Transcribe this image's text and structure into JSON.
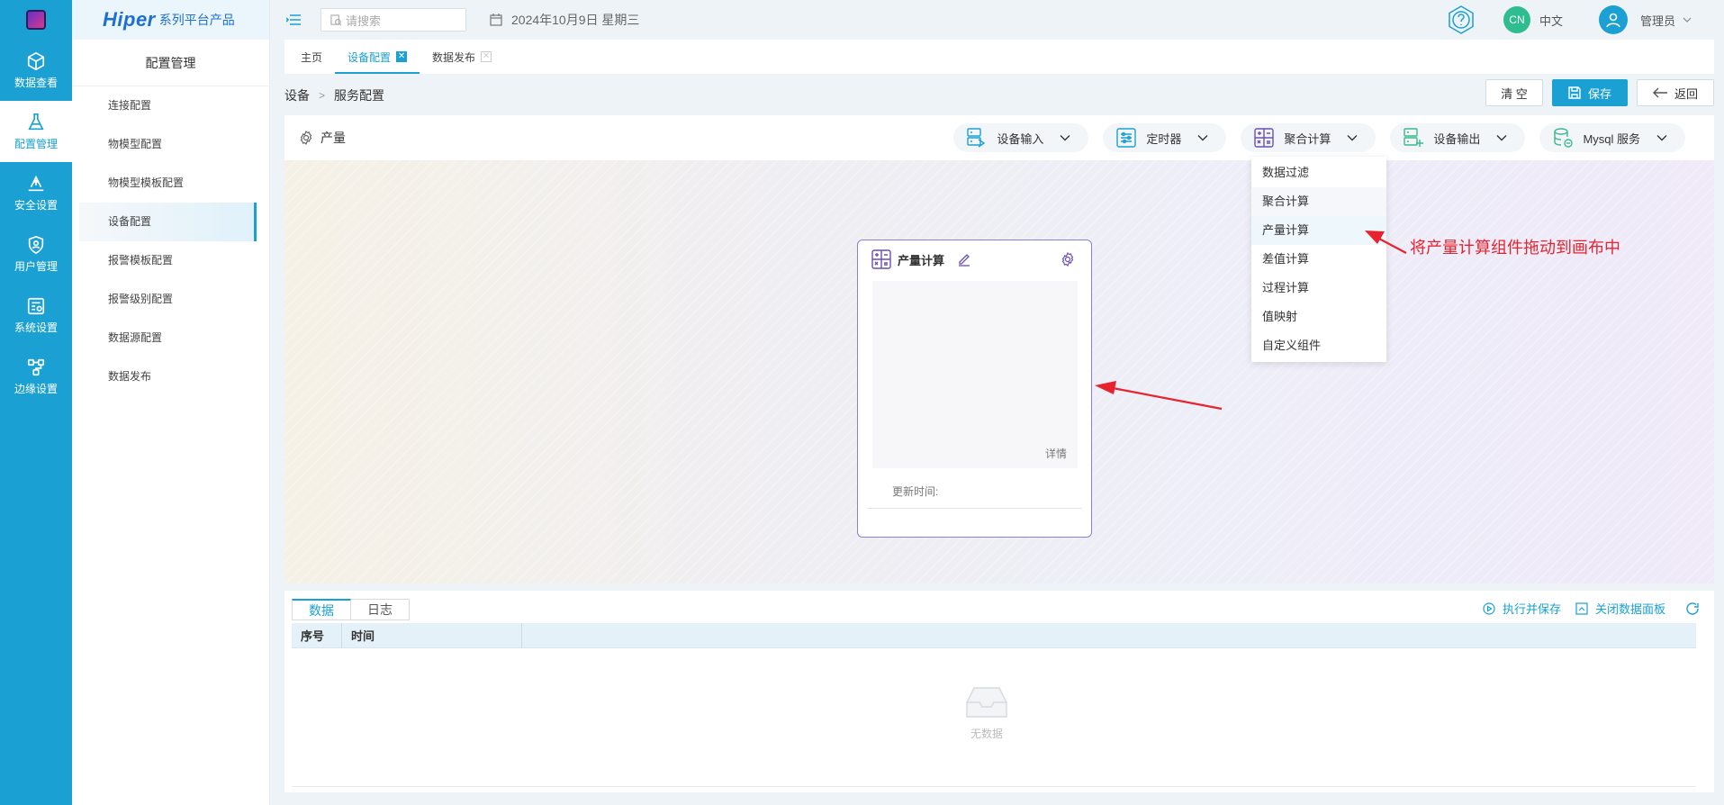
{
  "rail": {
    "items": [
      {
        "label": "数据查看",
        "icon": "cube-icon"
      },
      {
        "label": "配置管理",
        "icon": "flask-icon"
      },
      {
        "label": "安全设置",
        "icon": "shield-upload-icon"
      },
      {
        "label": "用户管理",
        "icon": "user-shield-icon"
      },
      {
        "label": "系统设置",
        "icon": "settings-panel-icon"
      },
      {
        "label": "边缘设置",
        "icon": "edge-nodes-icon"
      }
    ],
    "active_index": 1
  },
  "brand": {
    "main": "Hiper",
    "sub": "系列平台产品"
  },
  "subnav": {
    "title": "配置管理",
    "items": [
      "连接配置",
      "物模型配置",
      "物模型模板配置",
      "设备配置",
      "报警模板配置",
      "报警级别配置",
      "数据源配置",
      "数据发布"
    ],
    "active_index": 3
  },
  "header": {
    "search_placeholder": "请搜索",
    "date": "2024年10月9日 星期三",
    "lang_badge": "CN",
    "lang": "中文",
    "user": "管理员"
  },
  "tabs": [
    {
      "label": "主页",
      "closable": false
    },
    {
      "label": "设备配置",
      "closable": true,
      "active": true
    },
    {
      "label": "数据发布",
      "closable": true
    }
  ],
  "breadcrumb": [
    "设备",
    "服务配置"
  ],
  "actions": {
    "clear": "清 空",
    "save": "保存",
    "back": "返回"
  },
  "panel": {
    "title": "产量",
    "tools": [
      {
        "label": "设备输入",
        "icon": "device-input-icon"
      },
      {
        "label": "定时器",
        "icon": "timer-icon"
      },
      {
        "label": "聚合计算",
        "icon": "calculator-icon"
      },
      {
        "label": "设备输出",
        "icon": "device-output-icon"
      },
      {
        "label": "Mysql 服务",
        "icon": "database-icon"
      }
    ]
  },
  "dropdown": {
    "items": [
      "数据过滤",
      "聚合计算",
      "产量计算",
      "差值计算",
      "过程计算",
      "值映射",
      "自定义组件"
    ]
  },
  "node": {
    "title": "产量计算",
    "detail": "详情",
    "time_label": "更新时间:"
  },
  "annotation": {
    "text": "将产量计算组件拖动到画布中",
    "color": "#e8232f"
  },
  "data_panel": {
    "tabs": [
      "数据",
      "日志"
    ],
    "actions": {
      "run_save": "执行并保存",
      "close_panel": "关闭数据面板"
    },
    "columns": [
      "序号",
      "时间"
    ],
    "empty": "无数据"
  },
  "colors": {
    "accent": "#1aa0d2",
    "node_border": "#8b7fd6",
    "badge": "#2ebd8f"
  }
}
